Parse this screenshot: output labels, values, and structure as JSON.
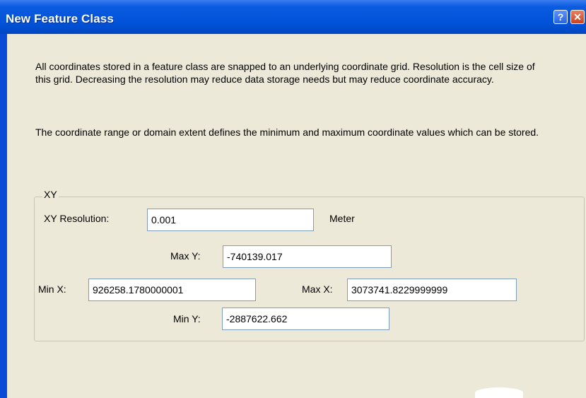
{
  "window": {
    "title": "New Feature Class",
    "help_label": "?",
    "close_label": "✕"
  },
  "description": {
    "paragraph1": "All coordinates stored in a feature class are snapped to an underlying coordinate grid. Resolution is the cell size of this grid. Decreasing the resolution may reduce data storage needs but may reduce coordinate accuracy.",
    "paragraph2": "The coordinate range or domain extent defines the minimum and maximum coordinate values which can be stored."
  },
  "xy_group": {
    "label": "XY",
    "resolution_label": "XY Resolution:",
    "resolution_value": "0.001",
    "resolution_unit": "Meter",
    "max_y_label": "Max Y:",
    "max_y_value": "-740139.017",
    "min_x_label": "Min X:",
    "min_x_value": "926258.1780000001",
    "max_x_label": "Max X:",
    "max_x_value": "3073741.8229999999",
    "min_y_label": "Min Y:",
    "min_y_value": "-2887622.662"
  },
  "colors": {
    "titlebar": "#0052d8",
    "dialog_background": "#ece9d8",
    "input_border": "#7f9db9"
  }
}
